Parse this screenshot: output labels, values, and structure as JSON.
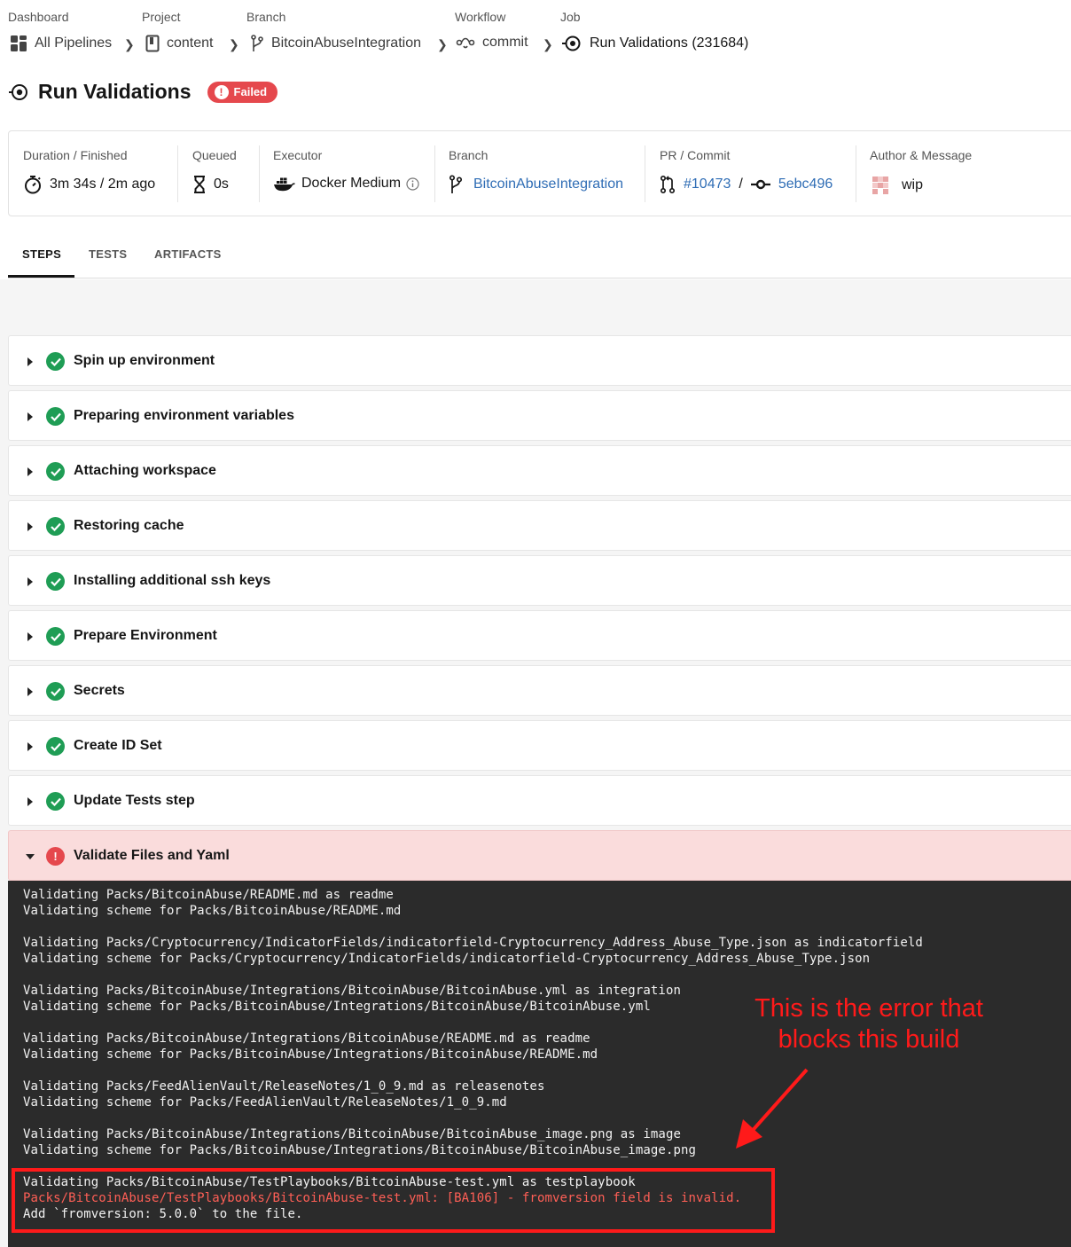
{
  "breadcrumb": {
    "dashboard": {
      "label": "Dashboard",
      "value": "All Pipelines"
    },
    "project": {
      "label": "Project",
      "value": "content"
    },
    "branch": {
      "label": "Branch",
      "value": "BitcoinAbuseIntegration"
    },
    "workflow": {
      "label": "Workflow",
      "value": "commit"
    },
    "job": {
      "label": "Job",
      "value": "Run Validations (231684)"
    }
  },
  "job": {
    "title": "Run Validations",
    "status": "Failed",
    "status_color": "#e5484d"
  },
  "info": {
    "duration": {
      "header": "Duration / Finished",
      "value": "3m 34s / 2m ago"
    },
    "queued": {
      "header": "Queued",
      "value": "0s"
    },
    "executor": {
      "header": "Executor",
      "value": "Docker Medium"
    },
    "branch": {
      "header": "Branch",
      "value": "BitcoinAbuseIntegration"
    },
    "pr_commit": {
      "header": "PR / Commit",
      "pr": "#10473",
      "separator": "/",
      "commit": "5ebc496"
    },
    "author": {
      "header": "Author & Message",
      "message": "wip"
    }
  },
  "tabs": [
    "STEPS",
    "TESTS",
    "ARTIFACTS"
  ],
  "steps": [
    {
      "name": "Spin up environment",
      "status": "success"
    },
    {
      "name": "Preparing environment variables",
      "status": "success"
    },
    {
      "name": "Attaching workspace",
      "status": "success"
    },
    {
      "name": "Restoring cache",
      "status": "success"
    },
    {
      "name": "Installing additional ssh keys",
      "status": "success"
    },
    {
      "name": "Prepare Environment",
      "status": "success"
    },
    {
      "name": "Secrets",
      "status": "success"
    },
    {
      "name": "Create ID Set",
      "status": "success"
    },
    {
      "name": "Update Tests step",
      "status": "success"
    },
    {
      "name": "Validate Files and Yaml",
      "status": "failed"
    }
  ],
  "console": [
    "Validating Packs/BitcoinAbuse/README.md as readme",
    "Validating scheme for Packs/BitcoinAbuse/README.md",
    "Validating Packs/Cryptocurrency/IndicatorFields/indicatorfield-Cryptocurrency_Address_Abuse_Type.json as indicatorfield",
    "Validating scheme for Packs/Cryptocurrency/IndicatorFields/indicatorfield-Cryptocurrency_Address_Abuse_Type.json",
    "Validating Packs/BitcoinAbuse/Integrations/BitcoinAbuse/BitcoinAbuse.yml as integration",
    "Validating scheme for Packs/BitcoinAbuse/Integrations/BitcoinAbuse/BitcoinAbuse.yml",
    "Validating Packs/BitcoinAbuse/Integrations/BitcoinAbuse/README.md as readme",
    "Validating scheme for Packs/BitcoinAbuse/Integrations/BitcoinAbuse/README.md",
    "Validating Packs/FeedAlienVault/ReleaseNotes/1_0_9.md as releasenotes",
    "Validating scheme for Packs/FeedAlienVault/ReleaseNotes/1_0_9.md",
    "Validating Packs/BitcoinAbuse/Integrations/BitcoinAbuse/BitcoinAbuse_image.png as image",
    "Validating scheme for Packs/BitcoinAbuse/Integrations/BitcoinAbuse/BitcoinAbuse_image.png",
    "Validating Packs/BitcoinAbuse/TestPlaybooks/BitcoinAbuse-test.yml as testplaybook",
    "Packs/BitcoinAbuse/TestPlaybooks/BitcoinAbuse-test.yml: [BA106] - fromversion field is invalid.",
    "Add `fromversion: 5.0.0` to the file."
  ],
  "annotation": {
    "line1": "This is the error that",
    "line2": "blocks this build",
    "color": "#ff1a1a"
  }
}
